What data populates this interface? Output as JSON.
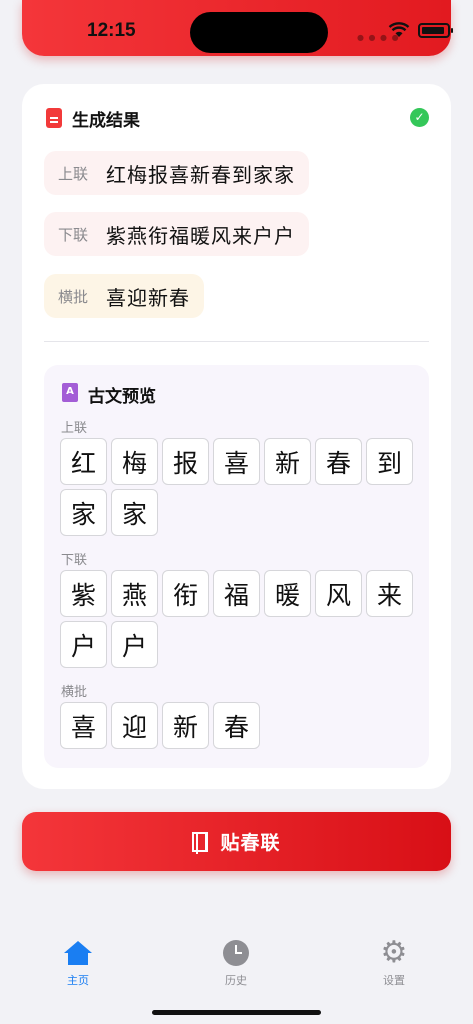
{
  "status_bar": {
    "time": "12:15"
  },
  "result_card": {
    "title": "生成结果",
    "upper": {
      "label": "上联",
      "text": "红梅报喜新春到家家"
    },
    "lower": {
      "label": "下联",
      "text": "紫燕衔福暖风来户户"
    },
    "horizontal": {
      "label": "横批",
      "text": "喜迎新春"
    }
  },
  "preview": {
    "title": "古文预览",
    "book_icon_letter": "A",
    "sections": [
      {
        "label": "上联",
        "glyphs": [
          "红",
          "梅",
          "报",
          "喜",
          "新",
          "春",
          "到",
          "家",
          "家"
        ]
      },
      {
        "label": "下联",
        "glyphs": [
          "紫",
          "燕",
          "衔",
          "福",
          "暖",
          "风",
          "来",
          "户",
          "户"
        ]
      },
      {
        "label": "横批",
        "glyphs": [
          "喜",
          "迎",
          "新",
          "春"
        ]
      }
    ]
  },
  "post_button": {
    "label": "贴春联"
  },
  "tabbar": {
    "items": [
      {
        "label": "主页",
        "icon": "home-icon",
        "active": true
      },
      {
        "label": "历史",
        "icon": "clock-icon",
        "active": false
      },
      {
        "label": "设置",
        "icon": "gear-icon",
        "active": false
      }
    ]
  },
  "colors": {
    "accent_red": "#f4363a",
    "tab_active": "#1a7ef2",
    "success": "#34c759",
    "preview_bg": "#f8f5fc"
  }
}
